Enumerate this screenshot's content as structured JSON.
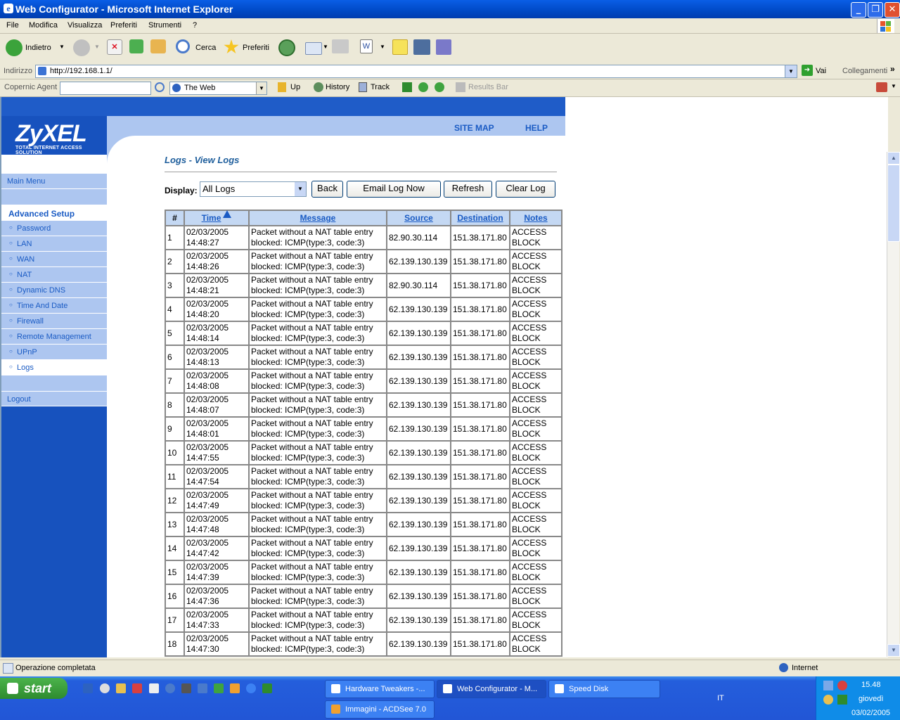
{
  "window": {
    "title": "Web Configurator - Microsoft Internet Explorer"
  },
  "menu": [
    "File",
    "Modifica",
    "Visualizza",
    "Preferiti",
    "Strumenti",
    "?"
  ],
  "toolbar": {
    "back": "Indietro",
    "search": "Cerca",
    "favorites": "Preferiti"
  },
  "address": {
    "label": "Indirizzo",
    "url": "http://192.168.1.1/",
    "go": "Vai",
    "links": "Collegamenti"
  },
  "copernic": {
    "label": "Copernic Agent",
    "scope": "The Web",
    "up": "Up",
    "history": "History",
    "track": "Track",
    "results": "Results Bar"
  },
  "header": {
    "logo": "ZyXEL",
    "tagline": "TOTAL INTERNET ACCESS SOLUTION",
    "sitemap": "SITE MAP",
    "help": "HELP"
  },
  "nav": {
    "main_menu": "Main Menu",
    "section": "Advanced Setup",
    "items": [
      "Password",
      "LAN",
      "WAN",
      "NAT",
      "Dynamic DNS",
      "Time And Date",
      "Firewall",
      "Remote Management",
      "UPnP",
      "Logs"
    ],
    "logout": "Logout"
  },
  "page": {
    "title": "Logs - View Logs",
    "display_label": "Display:",
    "display_value": "All Logs"
  },
  "buttons": {
    "back": "Back",
    "email": "Email Log Now",
    "refresh": "Refresh",
    "clear": "Clear Log"
  },
  "table": {
    "headers": [
      "#",
      "Time",
      "Message",
      "Source",
      "Destination",
      "Notes"
    ],
    "rows": [
      {
        "n": "1",
        "date": "02/03/2005",
        "time": "14:48:27",
        "msg1": "Packet without a NAT table entry",
        "msg2": "blocked: ICMP(type:3, code:3)",
        "src": "82.90.30.114",
        "dst": "151.38.171.80",
        "note1": "ACCESS",
        "note2": "BLOCK"
      },
      {
        "n": "2",
        "date": "02/03/2005",
        "time": "14:48:26",
        "msg1": "Packet without a NAT table entry",
        "msg2": "blocked: ICMP(type:3, code:3)",
        "src": "62.139.130.139",
        "dst": "151.38.171.80",
        "note1": "ACCESS",
        "note2": "BLOCK"
      },
      {
        "n": "3",
        "date": "02/03/2005",
        "time": "14:48:21",
        "msg1": "Packet without a NAT table entry",
        "msg2": "blocked: ICMP(type:3, code:3)",
        "src": "82.90.30.114",
        "dst": "151.38.171.80",
        "note1": "ACCESS",
        "note2": "BLOCK"
      },
      {
        "n": "4",
        "date": "02/03/2005",
        "time": "14:48:20",
        "msg1": "Packet without a NAT table entry",
        "msg2": "blocked: ICMP(type:3, code:3)",
        "src": "62.139.130.139",
        "dst": "151.38.171.80",
        "note1": "ACCESS",
        "note2": "BLOCK"
      },
      {
        "n": "5",
        "date": "02/03/2005",
        "time": "14:48:14",
        "msg1": "Packet without a NAT table entry",
        "msg2": "blocked: ICMP(type:3, code:3)",
        "src": "62.139.130.139",
        "dst": "151.38.171.80",
        "note1": "ACCESS",
        "note2": "BLOCK"
      },
      {
        "n": "6",
        "date": "02/03/2005",
        "time": "14:48:13",
        "msg1": "Packet without a NAT table entry",
        "msg2": "blocked: ICMP(type:3, code:3)",
        "src": "62.139.130.139",
        "dst": "151.38.171.80",
        "note1": "ACCESS",
        "note2": "BLOCK"
      },
      {
        "n": "7",
        "date": "02/03/2005",
        "time": "14:48:08",
        "msg1": "Packet without a NAT table entry",
        "msg2": "blocked: ICMP(type:3, code:3)",
        "src": "62.139.130.139",
        "dst": "151.38.171.80",
        "note1": "ACCESS",
        "note2": "BLOCK"
      },
      {
        "n": "8",
        "date": "02/03/2005",
        "time": "14:48:07",
        "msg1": "Packet without a NAT table entry",
        "msg2": "blocked: ICMP(type:3, code:3)",
        "src": "62.139.130.139",
        "dst": "151.38.171.80",
        "note1": "ACCESS",
        "note2": "BLOCK"
      },
      {
        "n": "9",
        "date": "02/03/2005",
        "time": "14:48:01",
        "msg1": "Packet without a NAT table entry",
        "msg2": "blocked: ICMP(type:3, code:3)",
        "src": "62.139.130.139",
        "dst": "151.38.171.80",
        "note1": "ACCESS",
        "note2": "BLOCK"
      },
      {
        "n": "10",
        "date": "02/03/2005",
        "time": "14:47:55",
        "msg1": "Packet without a NAT table entry",
        "msg2": "blocked: ICMP(type:3, code:3)",
        "src": "62.139.130.139",
        "dst": "151.38.171.80",
        "note1": "ACCESS",
        "note2": "BLOCK"
      },
      {
        "n": "11",
        "date": "02/03/2005",
        "time": "14:47:54",
        "msg1": "Packet without a NAT table entry",
        "msg2": "blocked: ICMP(type:3, code:3)",
        "src": "62.139.130.139",
        "dst": "151.38.171.80",
        "note1": "ACCESS",
        "note2": "BLOCK"
      },
      {
        "n": "12",
        "date": "02/03/2005",
        "time": "14:47:49",
        "msg1": "Packet without a NAT table entry",
        "msg2": "blocked: ICMP(type:3, code:3)",
        "src": "62.139.130.139",
        "dst": "151.38.171.80",
        "note1": "ACCESS",
        "note2": "BLOCK"
      },
      {
        "n": "13",
        "date": "02/03/2005",
        "time": "14:47:48",
        "msg1": "Packet without a NAT table entry",
        "msg2": "blocked: ICMP(type:3, code:3)",
        "src": "62.139.130.139",
        "dst": "151.38.171.80",
        "note1": "ACCESS",
        "note2": "BLOCK"
      },
      {
        "n": "14",
        "date": "02/03/2005",
        "time": "14:47:42",
        "msg1": "Packet without a NAT table entry",
        "msg2": "blocked: ICMP(type:3, code:3)",
        "src": "62.139.130.139",
        "dst": "151.38.171.80",
        "note1": "ACCESS",
        "note2": "BLOCK"
      },
      {
        "n": "15",
        "date": "02/03/2005",
        "time": "14:47:39",
        "msg1": "Packet without a NAT table entry",
        "msg2": "blocked: ICMP(type:3, code:3)",
        "src": "62.139.130.139",
        "dst": "151.38.171.80",
        "note1": "ACCESS",
        "note2": "BLOCK"
      },
      {
        "n": "16",
        "date": "02/03/2005",
        "time": "14:47:36",
        "msg1": "Packet without a NAT table entry",
        "msg2": "blocked: ICMP(type:3, code:3)",
        "src": "62.139.130.139",
        "dst": "151.38.171.80",
        "note1": "ACCESS",
        "note2": "BLOCK"
      },
      {
        "n": "17",
        "date": "02/03/2005",
        "time": "14:47:33",
        "msg1": "Packet without a NAT table entry",
        "msg2": "blocked: ICMP(type:3, code:3)",
        "src": "62.139.130.139",
        "dst": "151.38.171.80",
        "note1": "ACCESS",
        "note2": "BLOCK"
      },
      {
        "n": "18",
        "date": "02/03/2005",
        "time": "14:47:30",
        "msg1": "Packet without a NAT table entry",
        "msg2": "blocked: ICMP(type:3, code:3)",
        "src": "62.139.130.139",
        "dst": "151.38.171.80",
        "note1": "ACCESS",
        "note2": "BLOCK"
      }
    ]
  },
  "status": {
    "left": "Operazione completata",
    "zone": "Internet"
  },
  "taskbar": {
    "start": "start",
    "tasks": [
      "Hardware Tweakers -...",
      "Web Configurator - M...",
      "Speed Disk",
      "Immagini - ACDSee 7.0"
    ],
    "lang": "IT",
    "clock": "15.48",
    "day": "giovedì",
    "date": "03/02/2005"
  }
}
